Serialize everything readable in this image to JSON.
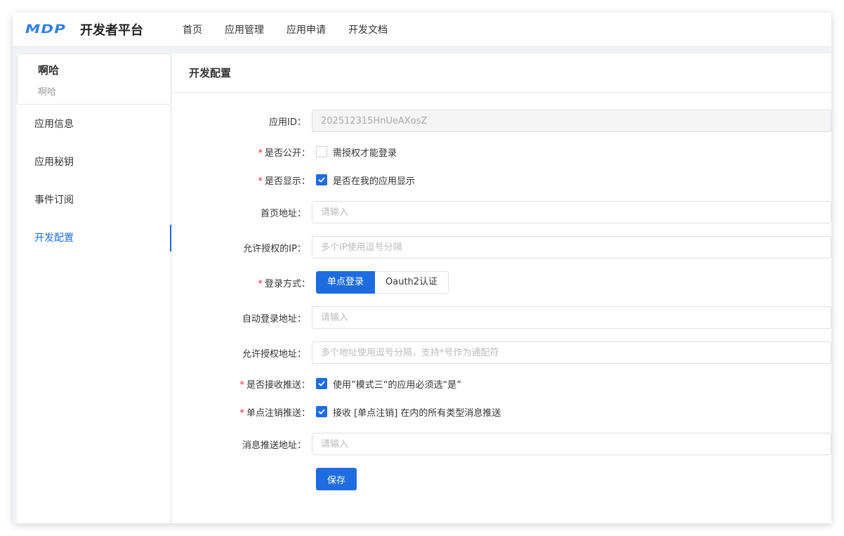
{
  "brand": {
    "logo_mark": "MDP",
    "title": "开发者平台",
    "accent": "#1e6ce0"
  },
  "nav": {
    "items": [
      "首页",
      "应用管理",
      "应用申请",
      "开发文档"
    ]
  },
  "app": {
    "name": "啊哈",
    "subtitle": "啊哈"
  },
  "sidebar": {
    "items": [
      {
        "label": "应用信息",
        "active": false
      },
      {
        "label": "应用秘钥",
        "active": false
      },
      {
        "label": "事件订阅",
        "active": false
      },
      {
        "label": "开发配置",
        "active": true
      }
    ]
  },
  "page": {
    "title": "开发配置"
  },
  "form": {
    "app_id": {
      "label": "应用ID",
      "value": "202512315HnUeAXosZ"
    },
    "is_public": {
      "label": "是否公开",
      "required": true,
      "checked": false,
      "text": "需授权才能登录"
    },
    "is_shown": {
      "label": "是否显示",
      "required": true,
      "checked": true,
      "text": "是否在我的应用显示"
    },
    "home_url": {
      "label": "首页地址",
      "placeholder": "请输入"
    },
    "allowed_ip": {
      "label": "允许授权的IP",
      "placeholder": "多个IP使用逗号分隔"
    },
    "login_method": {
      "label": "登录方式",
      "required": true,
      "options": [
        "单点登录",
        "Oauth2认证"
      ],
      "selected": "单点登录"
    },
    "auto_login_url": {
      "label": "自动登录地址",
      "placeholder": "请输入"
    },
    "allowed_auth_url": {
      "label": "允许授权地址",
      "placeholder": "多个地址使用逗号分隔，支持*号作为通配符"
    },
    "receive_push": {
      "label": "是否接收推送",
      "required": true,
      "checked": true,
      "text": "使用”模式三“的应用必须选“是”"
    },
    "sso_logout_push": {
      "label": "单点注销推送",
      "required": true,
      "checked": true,
      "text": "接收 [单点注销] 在内的所有类型消息推送"
    },
    "msg_push_url": {
      "label": "消息推送地址",
      "placeholder": "请输入"
    },
    "save_label": "保存"
  },
  "colon": "："
}
